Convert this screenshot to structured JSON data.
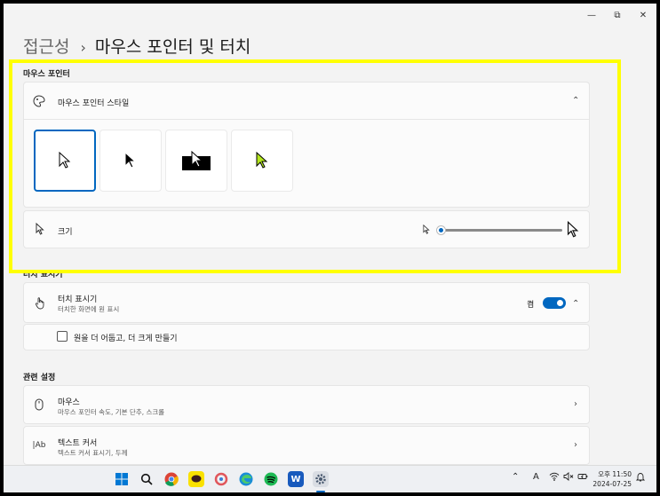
{
  "window": {
    "minimize_glyph": "—",
    "maximize_glyph": "⧉",
    "close_glyph": "✕"
  },
  "breadcrumb": {
    "parent": "접근성",
    "separator": "›",
    "current": "마우스 포인터 및 터치"
  },
  "pointer_section": {
    "title": "마우스 포인터",
    "style_row": {
      "label": "마우스 포인터 스타일",
      "icon": "pointer-style-icon",
      "expanded": true
    },
    "style_options": [
      {
        "name": "white",
        "selected": true
      },
      {
        "name": "black",
        "selected": false
      },
      {
        "name": "inverted",
        "selected": false
      },
      {
        "name": "custom",
        "selected": false,
        "color": "#b4e61e"
      }
    ],
    "size_row": {
      "label": "크기",
      "icon": "cursor-icon",
      "slider_value": 0
    }
  },
  "touch_section": {
    "title": "터치 표시기",
    "indicator_row": {
      "label": "터치 표시기",
      "sub": "터치한 화면에 원 표시",
      "toggle_label": "켬",
      "toggle_on": true
    },
    "checkbox_label": "원을 더 어둡고, 더 크게 만들기",
    "checkbox_checked": false
  },
  "related_section": {
    "title": "관련 설정",
    "items": [
      {
        "label": "마우스",
        "sub": "마우스 포인터 속도, 기본 단추, 스크롤",
        "icon": "mouse-icon"
      },
      {
        "label": "텍스트 커서",
        "sub": "텍스트 커서 표시기, 두께",
        "icon": "text-cursor-icon"
      }
    ]
  },
  "taskbar": {
    "apps": [
      "windows-start",
      "search",
      "chrome",
      "kakaotalk",
      "photo-editor",
      "edge",
      "spotify",
      "word",
      "settings"
    ],
    "tray": {
      "ime": "A",
      "time_period": "오후 11:50",
      "date": "2024-07-25"
    }
  },
  "colors": {
    "accent": "#0067c0",
    "highlight": "#ffff00",
    "background": "#f3f3f3"
  }
}
